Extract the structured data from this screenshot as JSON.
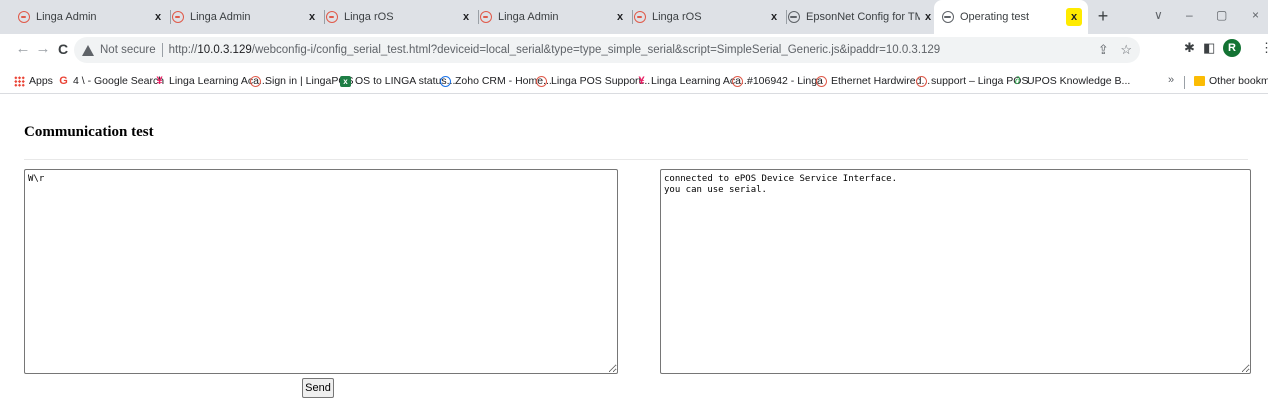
{
  "browser": {
    "tabs": [
      {
        "title": "Linga Admin",
        "close": "x",
        "icon": "linga-icon"
      },
      {
        "title": "Linga Admin",
        "close": "x",
        "icon": "linga-icon"
      },
      {
        "title": "Linga rOS",
        "close": "x",
        "icon": "linga-icon"
      },
      {
        "title": "Linga Admin",
        "close": "x",
        "icon": "linga-icon"
      },
      {
        "title": "Linga rOS",
        "close": "x",
        "icon": "linga-icon"
      },
      {
        "title": "EpsonNet Config for TM-i",
        "close": "x",
        "icon": "globe-icon"
      },
      {
        "title": "Operating test",
        "close": "x",
        "icon": "globe-icon"
      }
    ],
    "new_tab": "+",
    "window_controls": {
      "chevron": "∨",
      "minimize": "–",
      "restore": "▢",
      "close": "×"
    },
    "nav": {
      "back": "←",
      "forward": "→",
      "reload": "C"
    },
    "omnibox": {
      "security": "Not secure",
      "url_prefix": "http://",
      "url_host": "10.0.3.129",
      "url_rest": "/webconfig-i/config_serial_test.html?deviceid=local_serial&type=type_simple_serial&script=SimpleSerial_Generic.js&ipaddr=10.0.3.129",
      "share": "⇪",
      "star": "☆"
    },
    "toolbar_icons": {
      "extensions": "✱",
      "sidepanel": "◧",
      "menu": "⋮"
    },
    "profile_initial": "R",
    "bookmarks": [
      {
        "label": "Apps",
        "icon": "apps-icon"
      },
      {
        "label": "4 \\ - Google Search",
        "icon": "google-icon"
      },
      {
        "label": "Linga Learning Aca...",
        "icon": "person-icon"
      },
      {
        "label": "Sign in | LingaPOS",
        "icon": "linga-icon"
      },
      {
        "label": "OS to LINGA status...",
        "icon": "excel-icon"
      },
      {
        "label": "Zoho CRM - Home...",
        "icon": "zoho-icon"
      },
      {
        "label": "Linga POS Support...",
        "icon": "linga-icon"
      },
      {
        "label": "Linga Learning Aca...",
        "icon": "person-icon"
      },
      {
        "label": "#106942 - Linga",
        "icon": "linga-icon"
      },
      {
        "label": "Ethernet Hardwired...",
        "icon": "linga-icon"
      },
      {
        "label": "support – Linga POS",
        "icon": "linga-icon"
      },
      {
        "label": "UPOS Knowledge B...",
        "icon": "doc-icon"
      }
    ],
    "bookmarks_more": "»",
    "other_bookmarks": "Other bookmar"
  },
  "page": {
    "title": "Communication test",
    "send_text": "W\\r",
    "receive_text": "connected to ePOS Device Service Interface.\nyou can use serial.",
    "send_button": "Send"
  }
}
